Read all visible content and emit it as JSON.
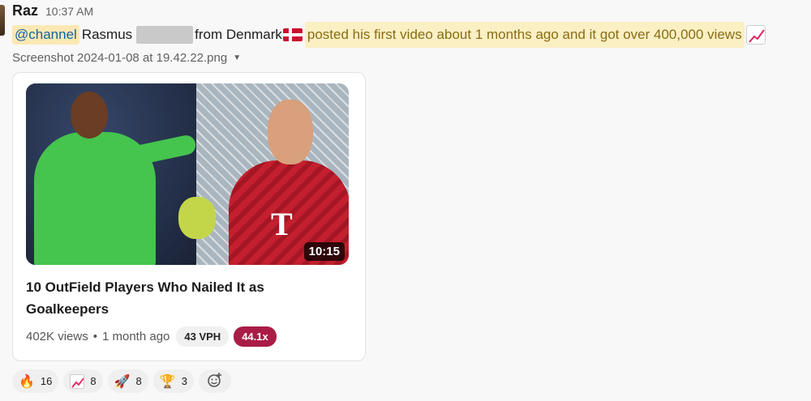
{
  "message": {
    "sender": "Raz",
    "time": "10:37 AM",
    "mention": "@channel",
    "text_name": "Rasmus",
    "text_from": "from Denmark",
    "flag_icon": "denmark-flag",
    "text_highlight": "posted his first video about 1 months ago and it got over 400,000 views",
    "emoji_icon": "chart-increasing"
  },
  "attachment": {
    "file_name": "Screenshot 2024-01-08 at 19.42.22.png",
    "video": {
      "duration": "10:15",
      "title": "10 OutField Players Who Nailed It as Goalkeepers",
      "views": "402K views",
      "separator": "•",
      "age": "1 month ago",
      "vph": "43 VPH",
      "multiplier": "44.1x"
    }
  },
  "reactions": [
    {
      "icon": "fire",
      "glyph": "🔥",
      "count": "16"
    },
    {
      "icon": "chart-increasing",
      "glyph": "",
      "count": "8"
    },
    {
      "icon": "rocket",
      "glyph": "🚀",
      "count": "8"
    },
    {
      "icon": "trophy",
      "glyph": "🏆",
      "count": "3"
    }
  ],
  "colors": {
    "mention_bg": "#fbe8b3",
    "mention_text": "#1264a3",
    "highlight_bg": "#fbefc4",
    "multiplier_bg": "#a91c46"
  }
}
